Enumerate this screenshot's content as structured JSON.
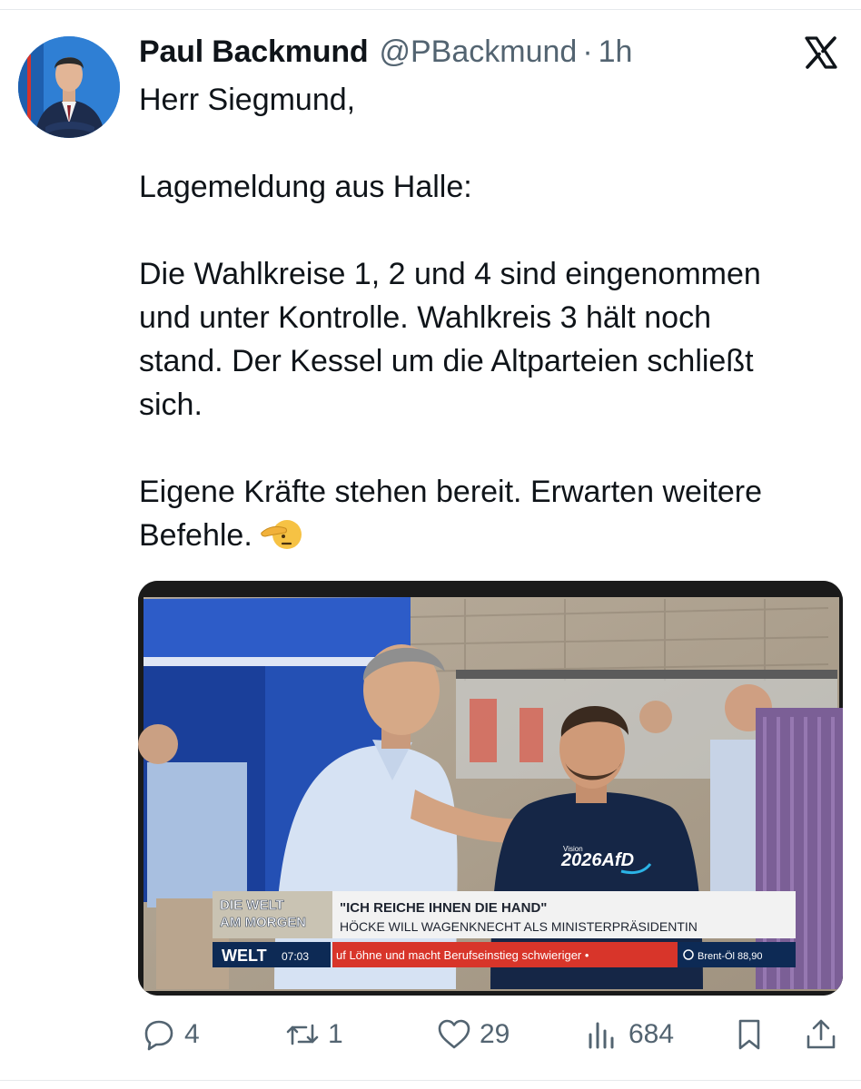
{
  "post": {
    "author_name": "Paul Backmund",
    "author_handle": "@PBackmund",
    "separator": "·",
    "age": "1h",
    "platform_logo": "x-logo",
    "avatar_icon": "profile-photo",
    "text_paragraphs": [
      [
        "Herr Siegmund,"
      ],
      [
        "Lagemeldung aus Halle:"
      ],
      [
        "Die Wahlkreise 1, 2 und 4 sind eingenommen",
        "und unter Kontrolle. Wahlkreis 3 hält noch",
        "stand. Der Kessel um die Altparteien schließt",
        "sich."
      ],
      [
        "Eigene Kräfte stehen bereit. Erwarten weitere",
        "Befehle."
      ]
    ],
    "emoji": "saluting-face-icon"
  },
  "media": {
    "shirt_text_small": "Vision",
    "shirt_text": "2026AfD",
    "show_bug_line1": "DIE WELT",
    "show_bug_line2": "AM MORGEN",
    "channel": "WELT",
    "time": "07:03",
    "headline": "\"ICH REICHE IHNEN DIE HAND\"",
    "subheadline": "HÖCKE WILL WAGENKNECHT ALS MINISTERPRÄSIDENTIN",
    "ticker": "uf Löhne und macht Berufseinstieg schwieriger •",
    "market": "Brent-Öl 88,90"
  },
  "actions": {
    "replies": "4",
    "reposts": "1",
    "likes": "29",
    "views": "684",
    "reply_icon": "speech-bubble-icon",
    "repost_icon": "repost-arrows-icon",
    "like_icon": "heart-icon",
    "views_icon": "bar-chart-icon",
    "bookmark_icon": "bookmark-icon",
    "share_icon": "share-icon"
  },
  "colors": {
    "text": "#0f1419",
    "secondary": "#536471",
    "ticker_red": "#d8352a",
    "welt_navy": "#0d2a55"
  }
}
